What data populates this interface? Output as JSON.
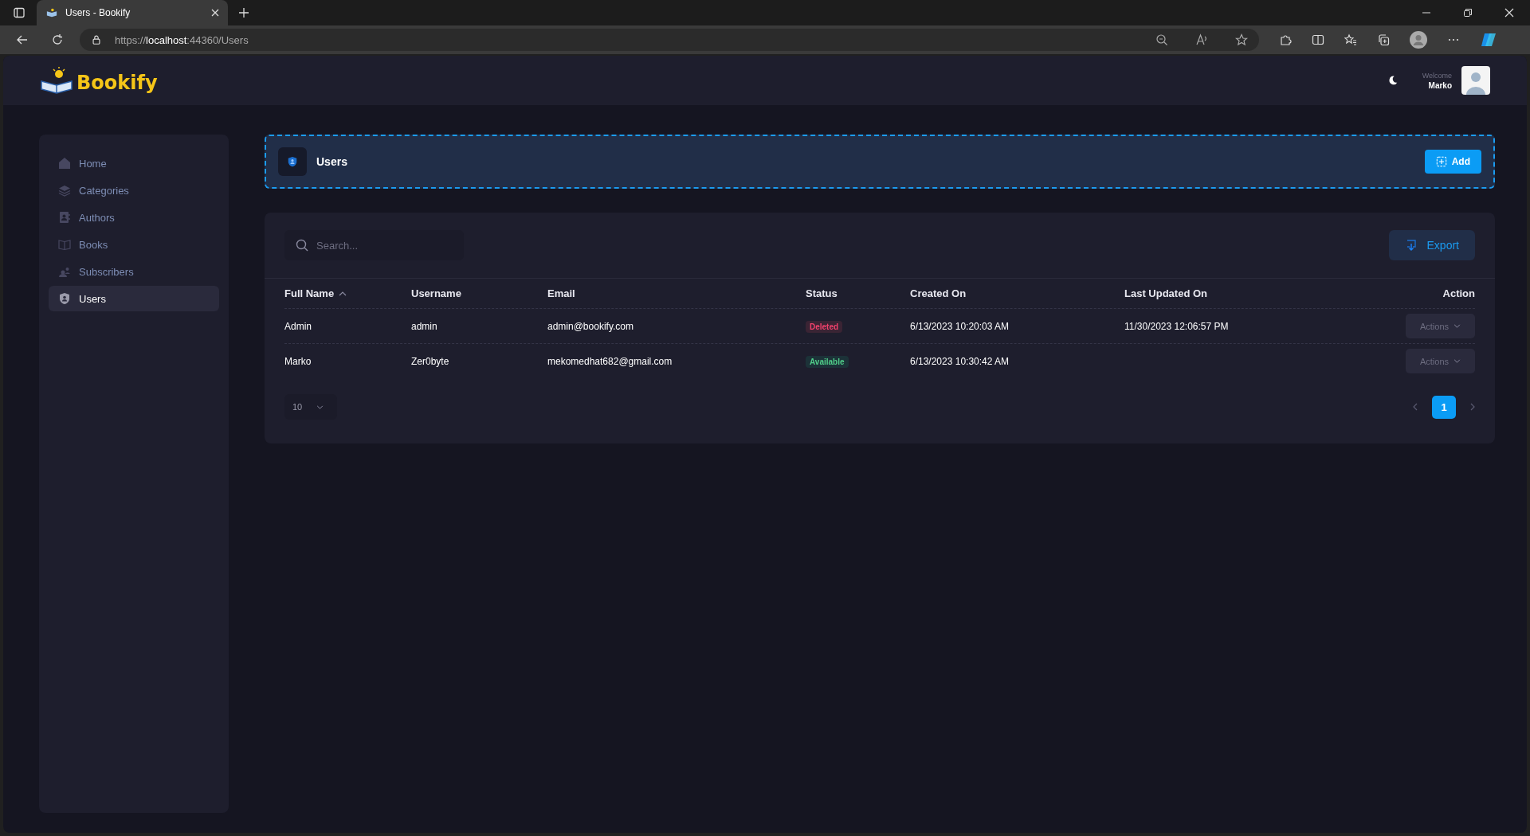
{
  "browser": {
    "tab_title": "Users - Bookify",
    "url_scheme": "https://",
    "url_host": "localhost",
    "url_rest": ":44360/Users"
  },
  "header": {
    "logo": "Bookify",
    "welcome": "Welcome",
    "user": "Marko"
  },
  "sidebar": {
    "items": [
      {
        "label": "Home",
        "selected": false
      },
      {
        "label": "Categories",
        "selected": false
      },
      {
        "label": "Authors",
        "selected": false
      },
      {
        "label": "Books",
        "selected": false
      },
      {
        "label": "Subscribers",
        "selected": false
      },
      {
        "label": "Users",
        "selected": true
      }
    ]
  },
  "page_title": "Users",
  "add_button": "Add",
  "search": {
    "placeholder": "Search..."
  },
  "export_button": "Export",
  "table": {
    "columns": [
      {
        "label": "Full Name",
        "sorted": true
      },
      {
        "label": "Username",
        "sorted": false
      },
      {
        "label": "Email",
        "sorted": false
      },
      {
        "label": "Status",
        "sorted": false
      },
      {
        "label": "Created On",
        "sorted": false
      },
      {
        "label": "Last Updated On",
        "sorted": false
      },
      {
        "label": "Action",
        "sorted": false
      }
    ],
    "rows": [
      {
        "full_name": "Admin",
        "username": "admin",
        "email": "admin@bookify.com",
        "status": {
          "label": "Deleted",
          "kind": "deleted"
        },
        "created_on": "6/13/2023 10:20:03 AM",
        "last_updated_on": "11/30/2023 12:06:57 PM",
        "action": "Actions"
      },
      {
        "full_name": "Marko",
        "username": "Zer0byte",
        "email": "mekomedhat682@gmail.com",
        "status": {
          "label": "Available",
          "kind": "available"
        },
        "created_on": "6/13/2023 10:30:42 AM",
        "action": "Actions"
      }
    ]
  },
  "page_size": "10",
  "pagination": {
    "pages": [
      {
        "label": "1",
        "selected": true
      }
    ]
  }
}
